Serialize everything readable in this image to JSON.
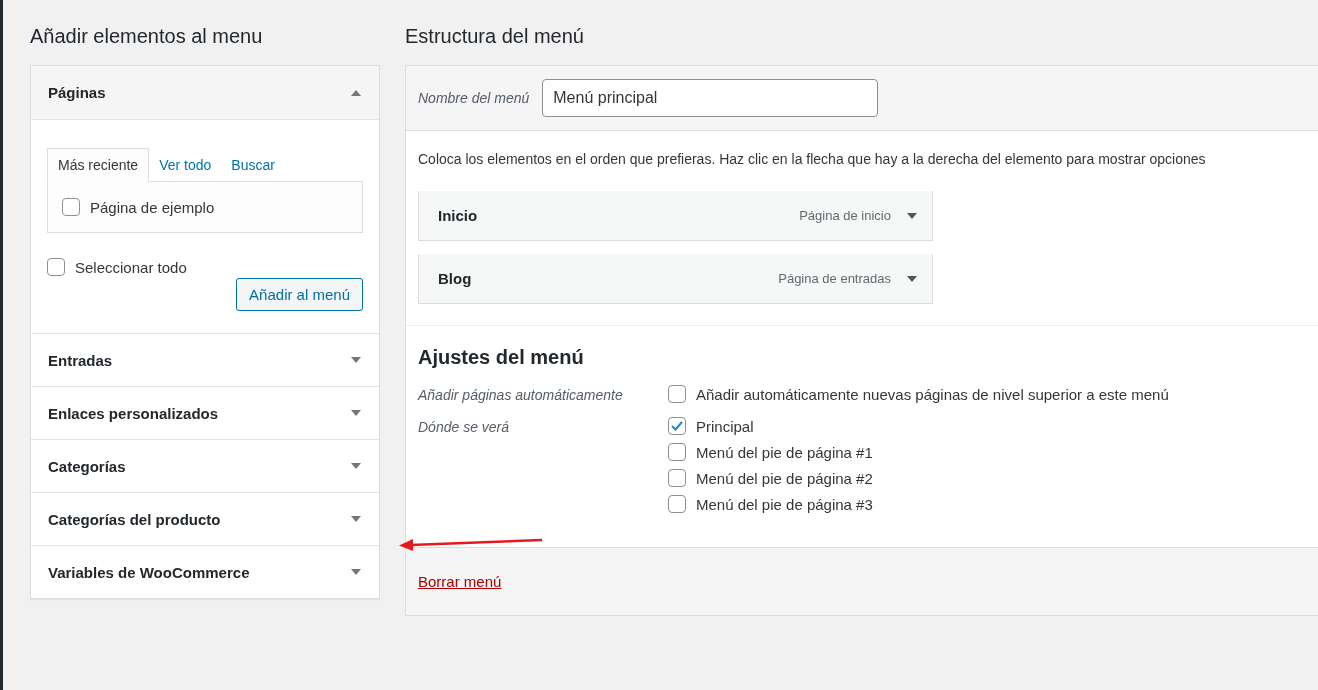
{
  "left": {
    "title": "Añadir elementos al menu",
    "sections": [
      {
        "title": "Páginas",
        "expanded": true,
        "tabs": [
          {
            "label": "Más reciente",
            "selected": true
          },
          {
            "label": "Ver todo",
            "selected": false
          },
          {
            "label": "Buscar",
            "selected": false
          }
        ],
        "items": [
          {
            "label": "Página de ejemplo",
            "checked": false
          }
        ],
        "select_all": {
          "label": "Seleccionar todo",
          "checked": false
        },
        "button": "Añadir al menú"
      },
      {
        "title": "Entradas",
        "expanded": false
      },
      {
        "title": "Enlaces personalizados",
        "expanded": false
      },
      {
        "title": "Categorías",
        "expanded": false
      },
      {
        "title": "Categorías del producto",
        "expanded": false
      },
      {
        "title": "Variables de WooCommerce",
        "expanded": false
      }
    ]
  },
  "right": {
    "title": "Estructura del menú",
    "name_label": "Nombre del menú",
    "name_value": "Menú principal",
    "description": "Coloca los elementos en el orden que prefieras. Haz clic en la flecha que hay a la derecha del elemento para mostrar opciones",
    "menu_items": [
      {
        "title": "Inicio",
        "type": "Página de inicio"
      },
      {
        "title": "Blog",
        "type": "Página de entradas"
      }
    ],
    "settings": {
      "title": "Ajustes del menú",
      "rows": [
        {
          "label": "Añadir páginas automáticamente",
          "options": [
            {
              "label": "Añadir automáticamente nuevas páginas de nivel superior a este menú",
              "checked": false
            }
          ]
        },
        {
          "label": "Dónde se verá",
          "options": [
            {
              "label": "Principal",
              "checked": true
            },
            {
              "label": "Menú del pie de página #1",
              "checked": false
            },
            {
              "label": "Menú del pie de página #2",
              "checked": false
            },
            {
              "label": "Menú del pie de página #3",
              "checked": false
            }
          ]
        }
      ]
    },
    "delete_link": "Borrar menú"
  }
}
